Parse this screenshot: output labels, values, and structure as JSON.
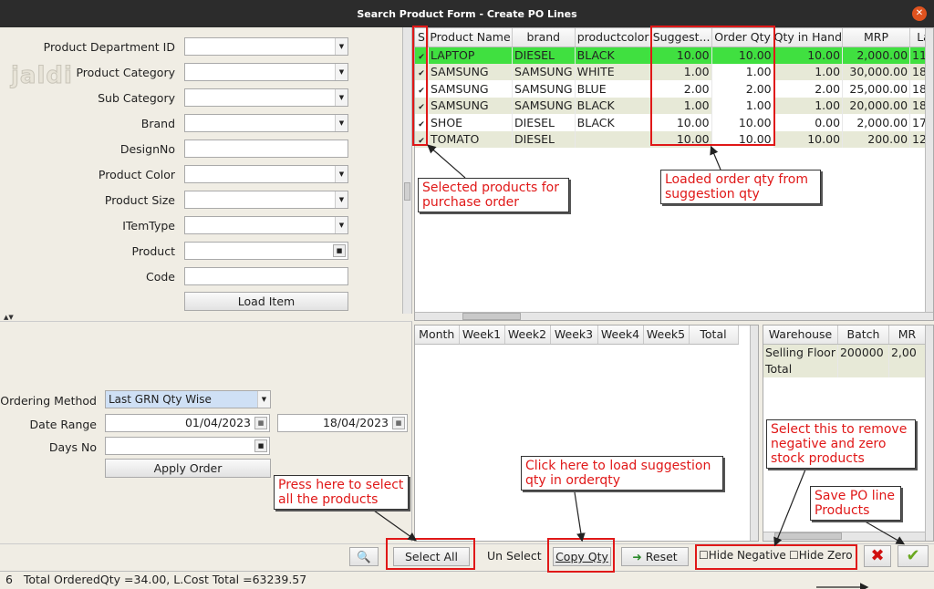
{
  "window": {
    "title": "Search Product Form - Create PO Lines",
    "close_glyph": "✕"
  },
  "logo": "jaldi",
  "form": {
    "fields": [
      {
        "label": "Product Department ID",
        "kind": "combo"
      },
      {
        "label": "Product Category",
        "kind": "combo"
      },
      {
        "label": "Sub Category",
        "kind": "combo"
      },
      {
        "label": "Brand",
        "kind": "combo"
      },
      {
        "label": "DesignNo",
        "kind": "text"
      },
      {
        "label": "Product Color",
        "kind": "combo"
      },
      {
        "label": "Product Size",
        "kind": "combo"
      },
      {
        "label": "ITemType",
        "kind": "combo"
      },
      {
        "label": "Product",
        "kind": "picker"
      },
      {
        "label": "Code",
        "kind": "text"
      }
    ],
    "load_button": "Load Item"
  },
  "ordering": {
    "method_label": "Ordering Method",
    "method_value": "Last GRN Qty Wise",
    "date_label": "Date Range",
    "date_from": "01/04/2023",
    "date_to": "18/04/2023",
    "days_label": "Days No",
    "days_value": "",
    "apply_button": "Apply Order"
  },
  "product_grid": {
    "columns": [
      "S",
      "Product Name",
      "brand",
      "productcolor",
      "Suggest...",
      "Order Qty",
      "Qty in Hand",
      "MRP",
      "La"
    ],
    "rows": [
      {
        "checked": "✔",
        "name": "LAPTOP",
        "brand": "DIESEL",
        "color": "BLACK",
        "suggest": "10.00",
        "order": "10.00",
        "hand": "10.00",
        "mrp": "2,000.00",
        "last": "11"
      },
      {
        "checked": "✔",
        "name": "SAMSUNG",
        "brand": "SAMSUNG",
        "color": "WHITE",
        "suggest": "1.00",
        "order": "1.00",
        "hand": "1.00",
        "mrp": "30,000.00",
        "last": "18"
      },
      {
        "checked": "✔",
        "name": "SAMSUNG",
        "brand": "SAMSUNG",
        "color": "BLUE",
        "suggest": "2.00",
        "order": "2.00",
        "hand": "2.00",
        "mrp": "25,000.00",
        "last": "18"
      },
      {
        "checked": "✔",
        "name": "SAMSUNG",
        "brand": "SAMSUNG",
        "color": "BLACK",
        "suggest": "1.00",
        "order": "1.00",
        "hand": "1.00",
        "mrp": "20,000.00",
        "last": "18"
      },
      {
        "checked": "✔",
        "name": "SHOE",
        "brand": "DIESEL",
        "color": "BLACK",
        "suggest": "10.00",
        "order": "10.00",
        "hand": "0.00",
        "mrp": "2,000.00",
        "last": "17"
      },
      {
        "checked": "✔",
        "name": "TOMATO",
        "brand": "DIESEL",
        "color": "",
        "suggest": "10.00",
        "order": "10.00",
        "hand": "10.00",
        "mrp": "200.00",
        "last": "12"
      }
    ]
  },
  "week_grid": {
    "columns": [
      "Month",
      "Week1",
      "Week2",
      "Week3",
      "Week4",
      "Week5",
      "Total"
    ]
  },
  "stock_grid": {
    "columns": [
      "Warehouse",
      "Batch",
      "MR"
    ],
    "rows": [
      {
        "warehouse": "Selling Floor",
        "batch": "200000",
        "mr": "2,00"
      },
      {
        "warehouse": "Total",
        "batch": "",
        "mr": ""
      }
    ]
  },
  "toolbar": {
    "select_all": "Select All",
    "unselect": "Un Select",
    "copy_qty": "Copy Qty",
    "reset": "Reset",
    "hide_negative": "Hide Negative",
    "hide_zero": "Hide Zero"
  },
  "status": {
    "count": "6",
    "summary": "Total OrderedQty =34.00, L.Cost Total =63239.57"
  },
  "annotations": {
    "selected_products": "Selected products for purchase order",
    "loaded_order_qty": "Loaded order qty from suggestion qty",
    "select_all_hint": "Press here to select all the products",
    "copy_qty_hint": "Click here to load suggestion qty in orderqty",
    "hide_hint": "Select this to remove negative and zero stock products",
    "save_hint": "Save PO line Products"
  },
  "colors": {
    "annotation": "#e01818",
    "selected_row": "#40e040",
    "alt_row": "#e7e9d7"
  }
}
